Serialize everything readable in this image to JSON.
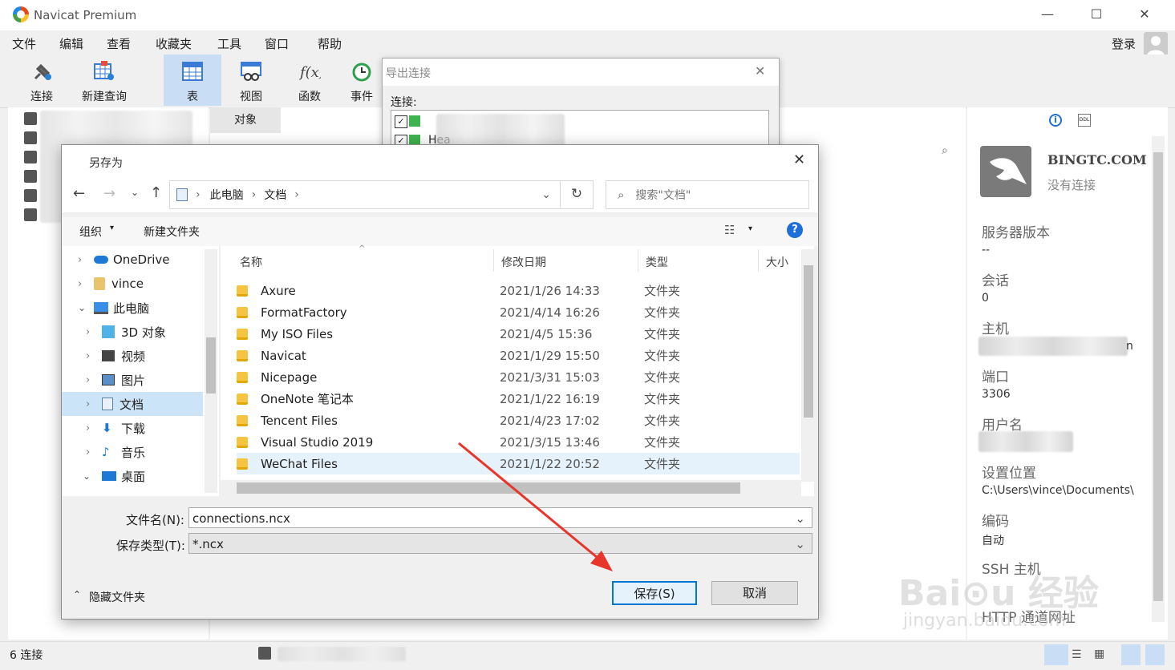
{
  "app": {
    "title": "Navicat Premium",
    "login_label": "登录"
  },
  "menu": [
    "文件",
    "编辑",
    "查看",
    "收藏夹",
    "工具",
    "窗口",
    "帮助"
  ],
  "toolbar": {
    "connect": "连接",
    "new_query": "新建查询",
    "table": "表",
    "view": "视图",
    "function": "函数",
    "event": "事件"
  },
  "tabs": {
    "objects": "对象"
  },
  "export_dialog": {
    "title": "导出连接",
    "connection_label": "连接:",
    "item2": "Hea"
  },
  "save_dialog": {
    "title": "另存为",
    "breadcrumb": [
      "此电脑",
      "文档"
    ],
    "search_placeholder": "搜索\"文档\"",
    "organize": "组织",
    "new_folder": "新建文件夹",
    "tree": [
      {
        "label": "OneDrive",
        "expanded": false
      },
      {
        "label": "vince",
        "expanded": false
      },
      {
        "label": "此电脑",
        "expanded": true
      },
      {
        "label": "3D 对象",
        "expanded": false
      },
      {
        "label": "视频",
        "expanded": false
      },
      {
        "label": "图片",
        "expanded": false
      },
      {
        "label": "文档",
        "expanded": false,
        "selected": true
      },
      {
        "label": "下载",
        "expanded": false
      },
      {
        "label": "音乐",
        "expanded": false
      },
      {
        "label": "桌面",
        "expanded": true
      }
    ],
    "columns": {
      "name": "名称",
      "date": "修改日期",
      "type": "类型",
      "size": "大小"
    },
    "files": [
      {
        "name": "Axure",
        "date": "2021/1/26 14:33",
        "type": "文件夹"
      },
      {
        "name": "FormatFactory",
        "date": "2021/4/14 16:26",
        "type": "文件夹"
      },
      {
        "name": "My ISO Files",
        "date": "2021/4/5 15:36",
        "type": "文件夹"
      },
      {
        "name": "Navicat",
        "date": "2021/1/29 15:50",
        "type": "文件夹"
      },
      {
        "name": "Nicepage",
        "date": "2021/3/31 15:03",
        "type": "文件夹"
      },
      {
        "name": "OneNote 笔记本",
        "date": "2021/1/22 16:19",
        "type": "文件夹"
      },
      {
        "name": "Tencent Files",
        "date": "2021/4/23 17:02",
        "type": "文件夹"
      },
      {
        "name": "Visual Studio 2019",
        "date": "2021/3/15 13:46",
        "type": "文件夹"
      },
      {
        "name": "WeChat Files",
        "date": "2021/1/22 20:52",
        "type": "文件夹"
      }
    ],
    "filename_label": "文件名(N):",
    "filename_value": "connections.ncx",
    "filetype_label": "保存类型(T):",
    "filetype_value": "*.ncx",
    "hide_folders": "隐藏文件夹",
    "save_button": "保存(S)",
    "cancel_button": "取消"
  },
  "info_panel": {
    "name": "BINGTC.COM",
    "status": "没有连接",
    "fields": [
      {
        "label": "服务器版本",
        "value": "--"
      },
      {
        "label": "会话",
        "value": "0"
      },
      {
        "label": "主机",
        "value": "n"
      },
      {
        "label": "端口",
        "value": "3306"
      },
      {
        "label": "用户名",
        "value": ""
      },
      {
        "label": "设置位置",
        "value": "C:\\Users\\vince\\Documents\\"
      },
      {
        "label": "编码",
        "value": "自动"
      },
      {
        "label": "SSH 主机",
        "value": ""
      },
      {
        "label": "HTTP 通道网址",
        "value": ""
      }
    ]
  },
  "statusbar": {
    "connections": "6 连接"
  },
  "colors": {
    "accent": "#0078d7",
    "selection": "#cce4f7",
    "arrow": "#e8362b"
  }
}
